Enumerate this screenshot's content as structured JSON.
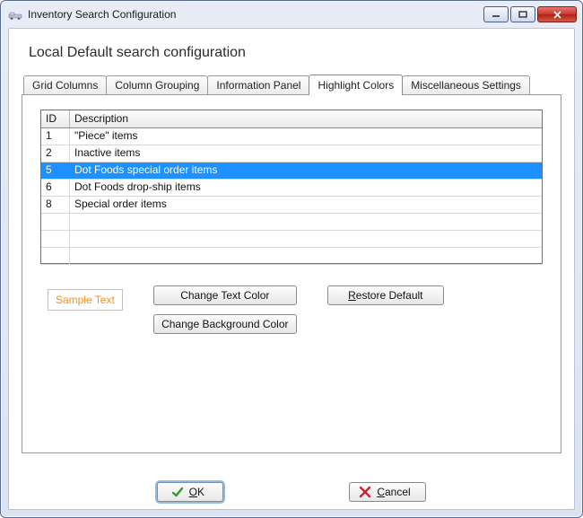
{
  "window": {
    "title": "Inventory Search Configuration"
  },
  "heading": "Local Default search configuration",
  "tabs": [
    {
      "label": "Grid Columns"
    },
    {
      "label": "Column Grouping"
    },
    {
      "label": "Information Panel"
    },
    {
      "label": "Highlight Colors"
    },
    {
      "label": "Miscellaneous Settings"
    }
  ],
  "active_tab_index": 3,
  "grid": {
    "columns": {
      "id": "ID",
      "description": "Description"
    },
    "rows": [
      {
        "id": "1",
        "description": "\"Piece\" items",
        "selected": false
      },
      {
        "id": "2",
        "description": "Inactive items",
        "selected": false
      },
      {
        "id": "5",
        "description": "Dot Foods special order items",
        "selected": true
      },
      {
        "id": "6",
        "description": "Dot Foods drop-ship items",
        "selected": false
      },
      {
        "id": "8",
        "description": "Special order items",
        "selected": false
      }
    ],
    "empty_rows": 3
  },
  "sample": {
    "text": "Sample Text",
    "text_color": "#ff8c1a",
    "bg_color": "#ffffff"
  },
  "buttons": {
    "change_text": "Change Text Color",
    "change_bg": "Change Background Color",
    "restore": "Restore Default",
    "ok_full": "OK",
    "ok_mnemonic": "O",
    "ok_rest": "K",
    "cancel_full": "Cancel",
    "cancel_mnemonic": "C",
    "cancel_rest": "ancel"
  },
  "colors": {
    "selection": "#1e90ff"
  }
}
